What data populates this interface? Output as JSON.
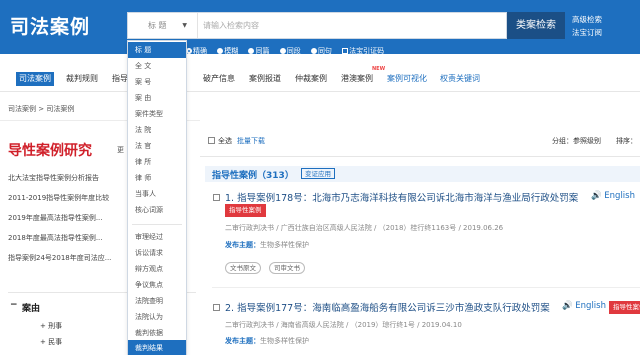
{
  "header": {
    "logo": "司法案例",
    "scope_selected": "标 题",
    "search_placeholder": "请输入检索内容",
    "search_button": "类案检索",
    "link_advanced": "高级检索",
    "link_subscribe": "法宝订阅"
  },
  "search_options": {
    "exact": "精确",
    "fuzzy": "模糊",
    "same_sentence": "同篇",
    "same_paragraph": "同段",
    "same_clause": "同句",
    "pinyin": "法宝引证码"
  },
  "nav": {
    "items": [
      "司法案例",
      "裁判规则",
      "指导",
      "破产信息",
      "案例报道",
      "仲裁案例",
      "港澳案例",
      "案例可视化",
      "权责关键词"
    ],
    "new_badge": "NEW"
  },
  "breadcrumb": "司法案例 > 司法案例",
  "left": {
    "title": "导性案例研究",
    "more": "更",
    "list": [
      "北大法宝指导性案例分析报告",
      "2011-2019指导性案例年度比较",
      "2019年度最高法指导性案例...",
      "2018年度最高法指导性案例...",
      "指导案例24号2018年度司法应..."
    ],
    "facet_title": "案由",
    "facet_items": [
      "刑事",
      "民事"
    ]
  },
  "dropdown": {
    "group1": [
      "标 题",
      "全 文",
      "案 号",
      "案 由",
      "案件类型",
      "法 院",
      "法 官",
      "律 所",
      "律 师",
      "当事人",
      "核心词源"
    ],
    "group2": [
      "审理经过",
      "诉讼请求",
      "辩方观点",
      "争议焦点",
      "法院查明",
      "法院认为",
      "裁判依据",
      "裁判结果"
    ],
    "selected": "标 题"
  },
  "results_bar": {
    "select_all": "全选",
    "batch_download": "批量下载",
    "group_label": "分组：参照级别",
    "sort_label": "排序："
  },
  "category": {
    "title": "指导性案例（",
    "count": "313",
    "close": "）",
    "button": "变证应用"
  },
  "cases": [
    {
      "title": "1. 指导案例178号：北海市乃志海洋科技有限公司诉北海市海洋与渔业局行政处罚案",
      "english": "English",
      "tag": "指导性案例",
      "meta": "二审行政判决书 / 广西壮族自治区高级人民法院 / （2018）桂行终1163号 / 2019.06.26",
      "topic_label": "发布主题：",
      "topic_value": "生物多样性保护",
      "btn_doc": "文书原文",
      "btn_ref": "司审文书"
    },
    {
      "title": "2. 指导案例177号：海南临高盈海船务有限公司诉三沙市渔政支队行政处罚案",
      "english": "English",
      "tag": "指导性案例",
      "meta": "二审行政判决书 / 海南省高级人民法院 / （2019）琼行终1号 / 2019.04.10",
      "topic_label": "发布主题：",
      "topic_value": "生物多样性保护"
    }
  ],
  "colors": {
    "brand_blue": "#1e6fbf",
    "dark_blue": "#1b4f86",
    "accent_red": "#e0393e"
  }
}
